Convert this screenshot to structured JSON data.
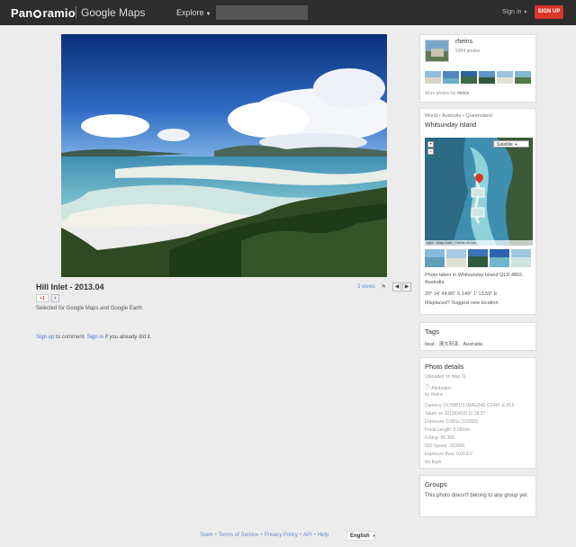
{
  "header": {
    "logo_text_a": "Pan",
    "logo_text_b": "ramio",
    "product": "Google Maps",
    "explore": "Explore",
    "signin": "Sign in",
    "signup": "SIGN UP"
  },
  "photo": {
    "title": "Hill Inlet - 2013.04",
    "views": "3 views",
    "gplus": "+1",
    "selected": "Selected for Google Maps and Google Earth"
  },
  "comment": {
    "signup_link": "Sign up",
    "text_a": " to comment. ",
    "signin_link": "Sign in",
    "text_b": " if you already did it."
  },
  "user": {
    "name": "rheins",
    "photos": "5304 photos",
    "more_prefix": "More photos by ",
    "more_user": "rheins"
  },
  "location": {
    "breadcrumb": "World • Australia • Queensland",
    "place": "Whitsunday Island",
    "map_type": "Satellite",
    "map_footer": "ogle - Map Data  |  Terms of Use",
    "taken": "Photo taken in Whitsunday Island QLD 4802, Australia",
    "coords": "20° 14' 44.86\" S   149° 1' 13.59\" E",
    "misplaced": "Misplaced? Suggest new location"
  },
  "tags": {
    "title": "Tags",
    "list": "beat · 澳大利亚 · Australia"
  },
  "details": {
    "title": "Photo details",
    "uploaded": "Uploaded on May 11",
    "attribution": "Attribution",
    "by": "by rheins",
    "lines": [
      "Camera: OLYMPUS IMAGING CORP. E-PL5",
      "Taken on 2013/04/20 11:18:37",
      "Exposure: 0.001s (1/2000)",
      "Focal Length: 9.00mm",
      "F/Stop: f/6.300",
      "ISO Speed: ISO200",
      "Exposure Bias: 0.00 EV",
      "No flash"
    ]
  },
  "groups": {
    "title": "Groups",
    "text": "This photo doesn't belong to any group yet."
  },
  "footer": {
    "links": [
      "Team",
      "Terms of Service",
      "Privacy Policy",
      "API",
      "Help"
    ],
    "language": "English"
  },
  "colors": {
    "topbar": "#2d2d2d",
    "signup": "#d9362b",
    "link": "#6a8cc7"
  }
}
